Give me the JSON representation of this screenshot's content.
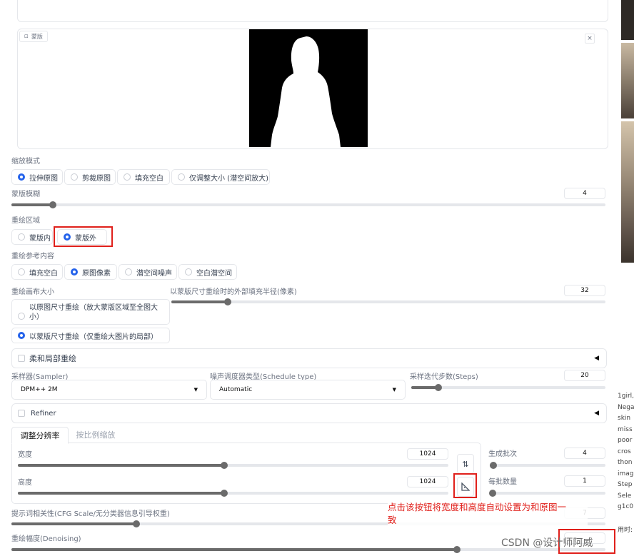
{
  "mask_panel": {
    "tag": "蒙版"
  },
  "resize_mode": {
    "label": "缩放模式",
    "options": [
      "拉伸原图",
      "剪裁原图",
      "填充空白",
      "仅调整大小 (潜空间放大)"
    ],
    "selected": 0
  },
  "mask_blur": {
    "label": "蒙版模糊",
    "value": "4",
    "fraction": 0.07
  },
  "inpaint_area": {
    "label": "重绘区域",
    "options": [
      "蒙版内",
      "蒙版外"
    ],
    "selected": 1
  },
  "masked_content": {
    "label": "重绘参考内容",
    "options": [
      "填充空白",
      "原图像素",
      "潜空间噪声",
      "空白潜空间"
    ],
    "selected": 1
  },
  "inpaint_canvas": {
    "label": "重绘画布大小",
    "options": [
      "以原图尺寸重绘（放大蒙版区域至全图大小）",
      "以蒙版尺寸重绘（仅重绘大图片的局部）"
    ],
    "selected": 1
  },
  "padding": {
    "label": "以蒙版尺寸重绘时的外部填充半径(像素)",
    "value": "32",
    "fraction": 0.13
  },
  "soft_inpaint": {
    "label": "柔和局部重绘"
  },
  "sampler": {
    "label": "采样器(Sampler)",
    "value": "DPM++ 2M"
  },
  "schedule": {
    "label": "噪声调度器类型(Schedule type)",
    "value": "Automatic"
  },
  "steps": {
    "label": "采样迭代步数(Steps)",
    "value": "20",
    "fraction": 0.14
  },
  "refiner": {
    "label": "Refiner"
  },
  "tabs": {
    "active": "调整分辨率",
    "inactive": "按比例缩放"
  },
  "width": {
    "label": "宽度",
    "value": "1024",
    "fraction": 0.48
  },
  "height": {
    "label": "高度",
    "value": "1024",
    "fraction": 0.48
  },
  "batch_count": {
    "label": "生成批次",
    "value": "4",
    "fraction": 0.03
  },
  "batch_size": {
    "label": "每批数量",
    "value": "1",
    "fraction": 0.0
  },
  "cfg": {
    "label": "提示词相关性(CFG Scale/无分类器信息引导权重)",
    "value": "7",
    "fraction": 0.21
  },
  "denoise": {
    "label": "重绘幅度(Denoising)",
    "fraction": 0.75
  },
  "annotation": {
    "line1": "点击该按钮将宽度和高度自动设置为和原图一",
    "line2": "致"
  },
  "watermark": "CSDN @设计师阿威",
  "side_lines": [
    "1girl,",
    "Nega",
    "skin",
    "miss",
    "poor",
    "cros",
    "thon",
    "imag",
    "Step",
    "Sele",
    "g1c0",
    "用时:"
  ],
  "colors": {
    "accent": "#2563eb",
    "red": "#e0201b",
    "slider": "#6b6b6b"
  }
}
